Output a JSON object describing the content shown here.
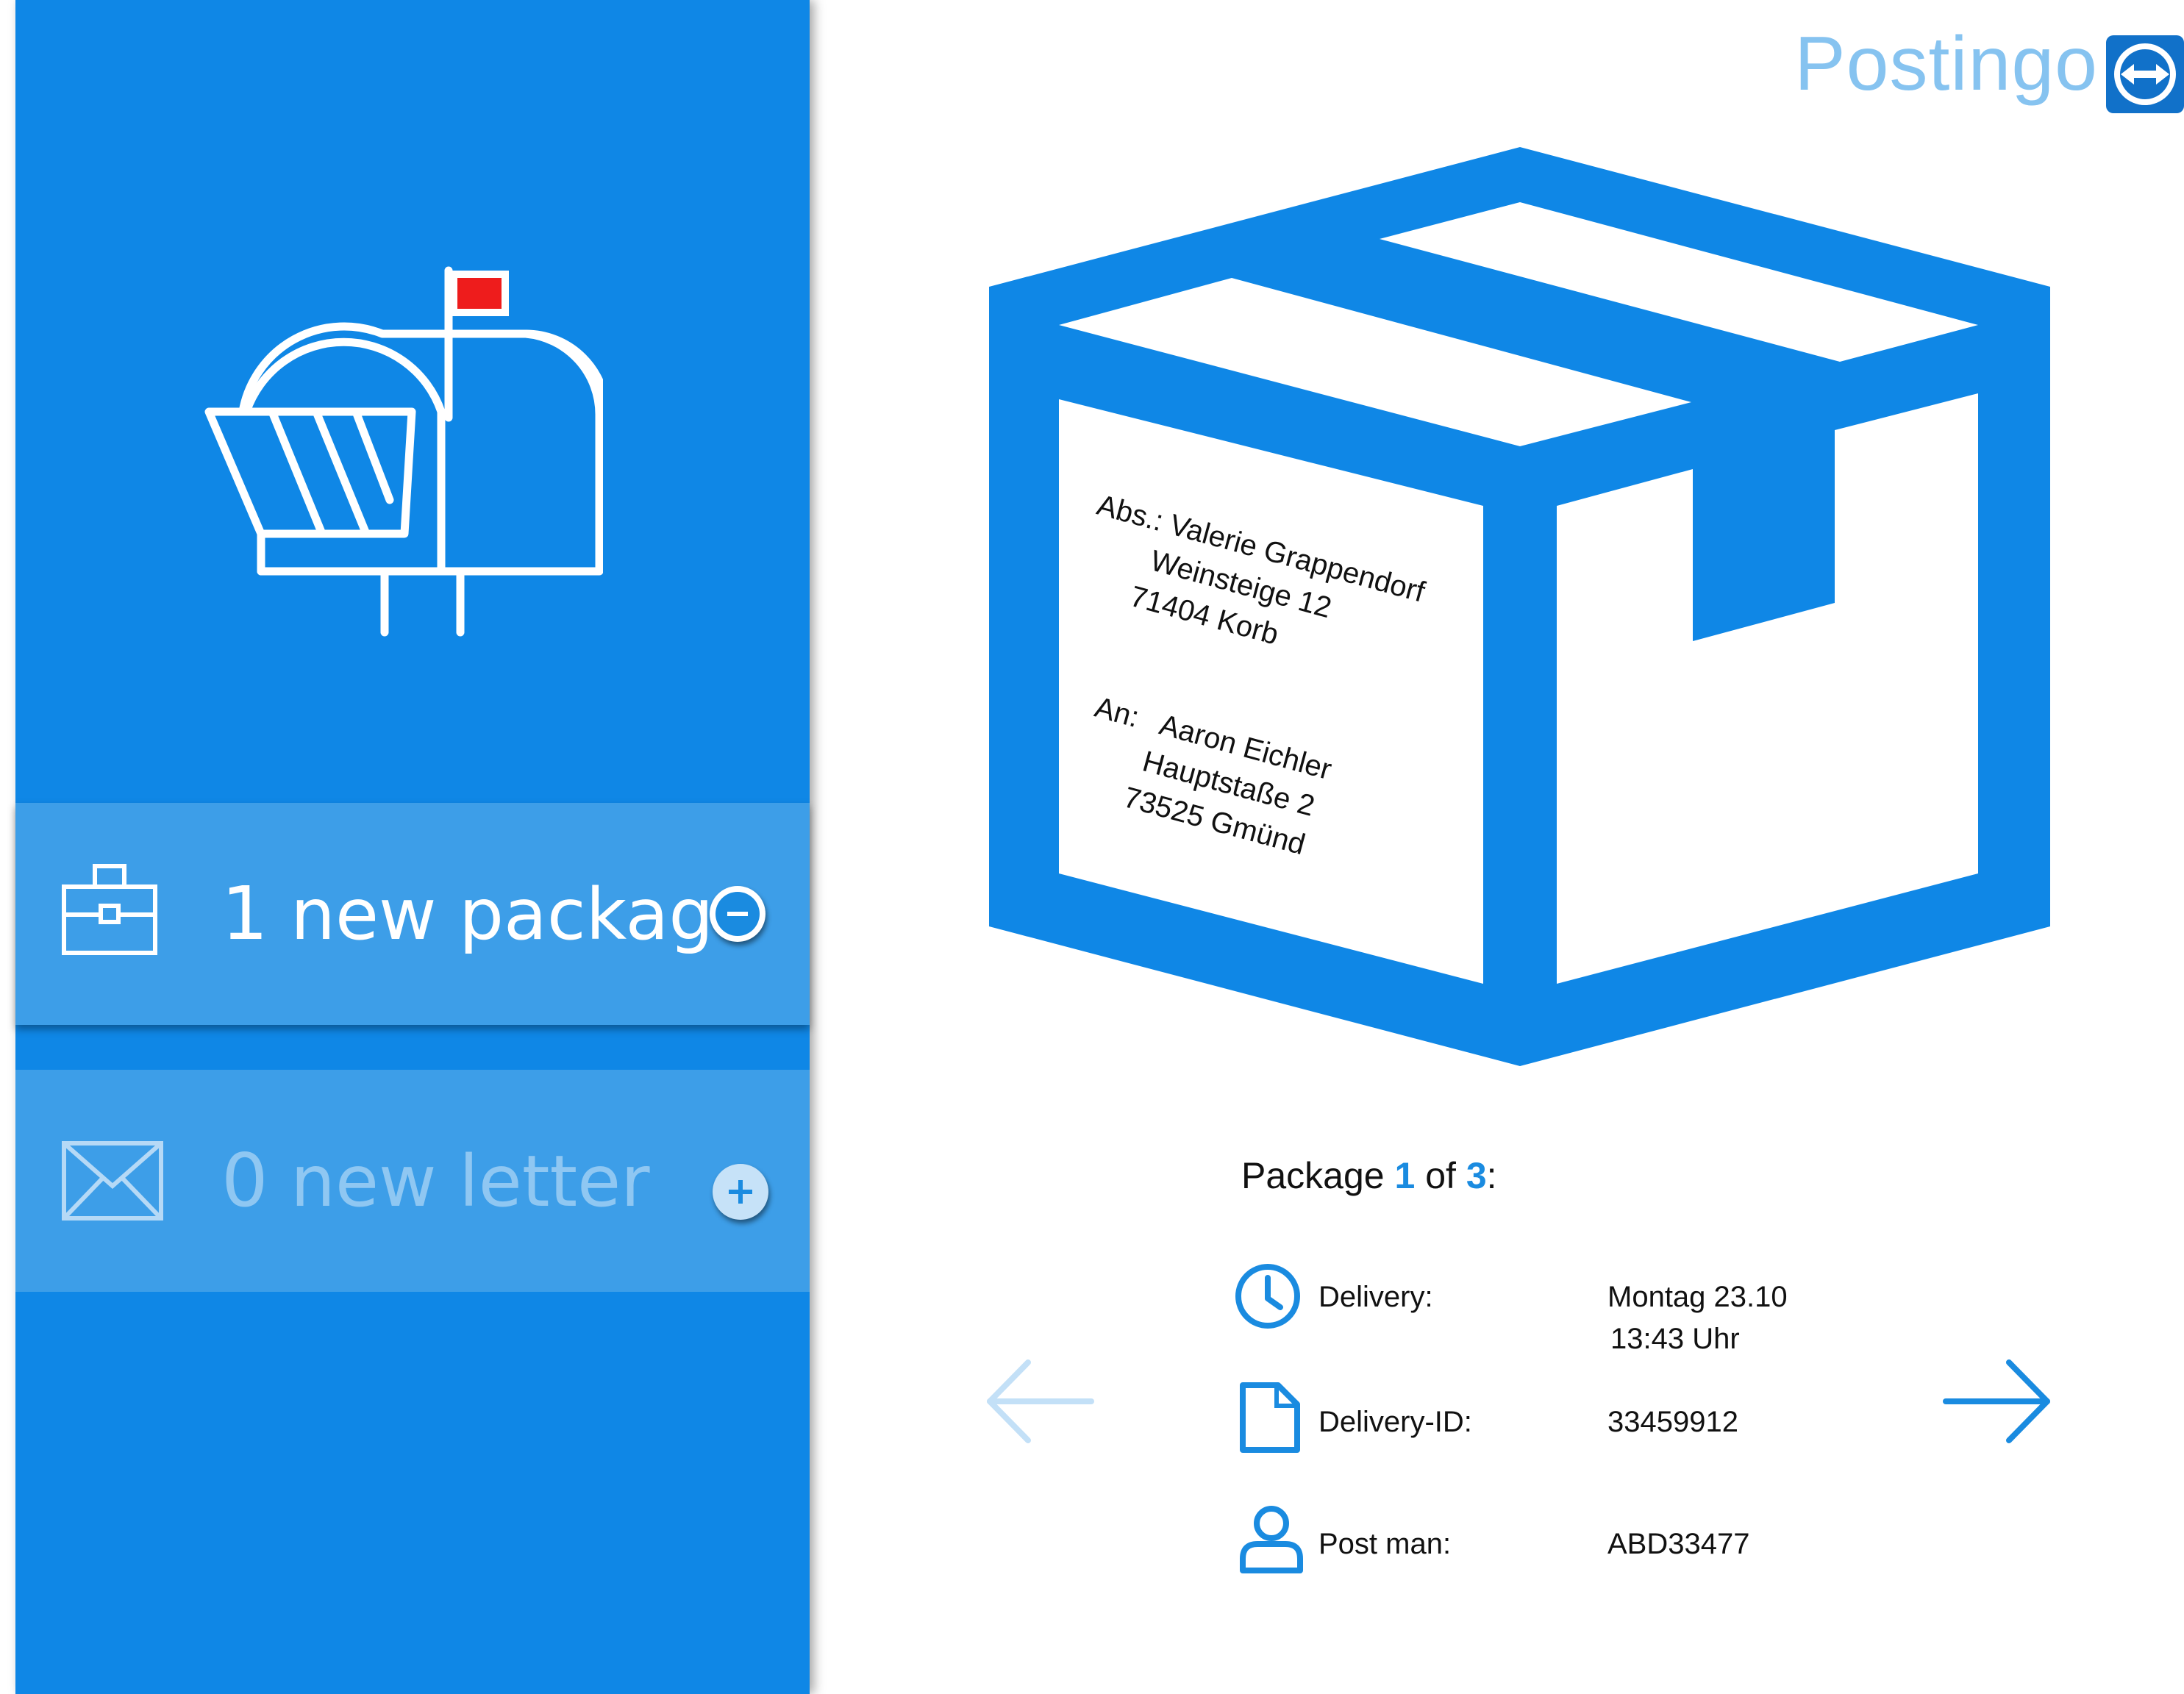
{
  "app": {
    "name": "Postingo",
    "logo_icon": "teamviewer-arrows-icon"
  },
  "colors": {
    "primary": "#0f87e6",
    "row_bg": "#3d9ee8",
    "flag": "#ee1c1c",
    "brand_text": "#86c3f0"
  },
  "sidebar": {
    "mailbox_icon": "mailbox-with-flag-icon",
    "package_row": {
      "icon": "briefcase-icon",
      "count": "1",
      "label": "new package",
      "button_icon": "minus-icon"
    },
    "letter_row": {
      "icon": "envelope-icon",
      "count": "0",
      "label": "new letter",
      "button_icon": "plus-icon"
    }
  },
  "package_label": {
    "sender_prefix": "Abs.:",
    "sender_name": "Valerie Grappendorf",
    "sender_street": "Weinsteige 12",
    "sender_city": "71404 Korb",
    "recipient_prefix": "An:",
    "recipient_name": "Aaron Eichler",
    "recipient_street": "Hauptstaße 2",
    "recipient_city": "73525 Gmünd"
  },
  "details": {
    "heading_prefix": "Package",
    "current": "1",
    "of_word": "of",
    "total": "3",
    "heading_suffix": ":",
    "delivery_label": "Delivery:",
    "delivery_day": "Montag 23.10",
    "delivery_time": "13:43 Uhr",
    "delivery_id_label": "Delivery-ID:",
    "delivery_id_value": "33459912",
    "postman_label": "Post man:",
    "postman_value": "ABD33477"
  },
  "navigation": {
    "prev_icon": "arrow-left-icon",
    "next_icon": "arrow-right-icon"
  }
}
